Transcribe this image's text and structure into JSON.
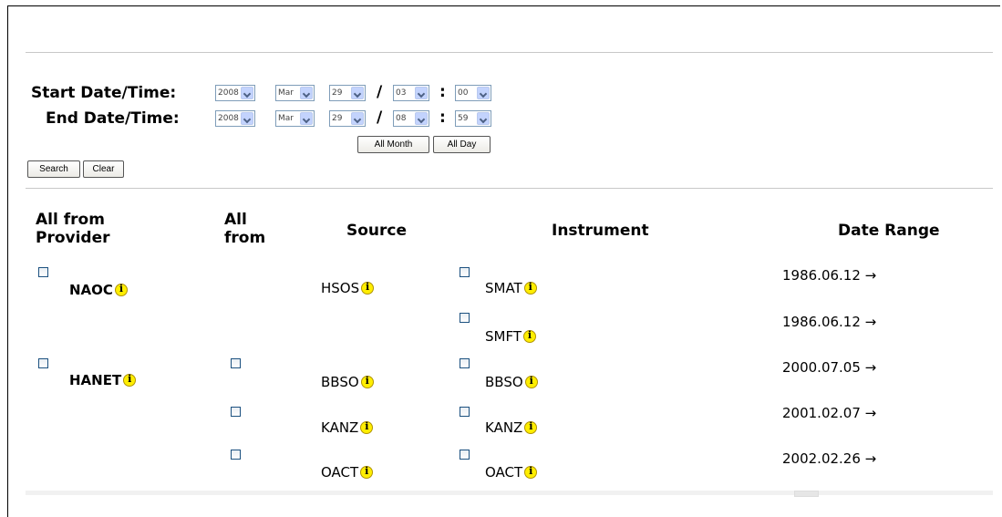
{
  "form": {
    "start_label": "Start Date/Time:",
    "end_label": "End Date/Time:",
    "start": {
      "year": "2008",
      "month": "Mar",
      "day": "29",
      "hour": "03",
      "minute": "00"
    },
    "end": {
      "year": "2008",
      "month": "Mar",
      "day": "29",
      "hour": "08",
      "minute": "59"
    },
    "slash": "/",
    "colon": ":",
    "all_month_label": "All Month",
    "all_day_label": "All Day",
    "search_label": "Search",
    "clear_label": "Clear"
  },
  "table": {
    "headers": {
      "provider": "All from Provider",
      "all_from": "All from",
      "source": "Source",
      "instrument": "Instrument",
      "date_range": "Date Range"
    },
    "providers": [
      "NAOC",
      "HANET"
    ],
    "sources": [
      "HSOS",
      "BBSO",
      "KANZ",
      "OACT"
    ],
    "rows": [
      {
        "instrument": "SMAT",
        "date": "1986.06.12 →"
      },
      {
        "instrument": "SMFT",
        "date": "1986.06.12 →"
      },
      {
        "instrument": "BBSO",
        "date": "2000.07.05 →"
      },
      {
        "instrument": "KANZ",
        "date": "2001.02.07 →"
      },
      {
        "instrument": "OACT",
        "date": "2002.02.26 →"
      }
    ]
  }
}
